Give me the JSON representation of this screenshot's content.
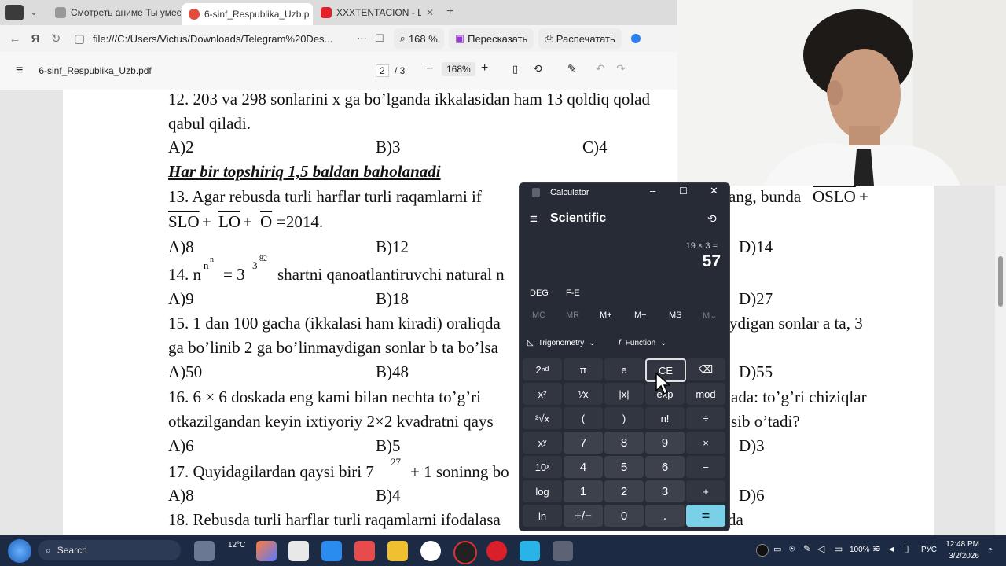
{
  "browser": {
    "tabs": [
      {
        "label": "Смотреть аниме Ты умее",
        "active": false
      },
      {
        "label": "6-sinf_Respublika_Uzb.p",
        "active": true
      },
      {
        "label": "XXXTENTACION - Le",
        "active": false
      }
    ],
    "address": "file:///C:/Users/Victus/Downloads/Telegram%20Des...",
    "zoom": "168 %",
    "retell_label": "Пересказать",
    "print_label": "Распечатать"
  },
  "pdf": {
    "filename": "6-sinf_Respublika_Uzb.pdf",
    "page_current": "2",
    "page_total": "/ 3",
    "zoom": "168%"
  },
  "document": {
    "lines": [
      "12. 203 va 298 sonlarini x ga bo’lganda ikkalasidan ham 13 qoldiq qolad",
      "qabul qiladi.",
      "Har bir topshiriq 1,5 baldan baholanadi",
      "13. Agar rebusda turli harflar turli raqamlarni if",
      "ang, bunda",
      "OSLO",
      "SLO",
      "LO",
      "O",
      "=2014.",
      "14. n",
      "shartni qanoatlantiruvchi  natural n",
      "15. 1 dan 100 gacha (ikkalasi ham kiradi) oraliqda",
      "ydigan sonlar a ta, 3",
      "ga bo’linib 2 ga bo’linmaydigan sonlar b ta bo’lsa",
      "16. 6 × 6 doskada eng kami bilan nechta to’g’ri",
      "ada: to’g’ri chiziqlar",
      "otkazilgandan keyin ixtiyoriy 2×2 kvadratni qays",
      "sib o’tadi?",
      "17. Quyidagilardan qaysi biri  7",
      "27",
      "+ 1 soninng bo",
      "18. Rebusda turli harflar turli raqamlarni ifodalasa",
      "da"
    ],
    "options": [
      [
        "A)2",
        "B)3",
        "C)4"
      ],
      [
        "A)8",
        "B)12",
        "D)14"
      ],
      [
        "A)9",
        "B)18",
        "D)27"
      ],
      [
        "A)50",
        "B)48",
        "D)55"
      ],
      [
        "A)6",
        "B)5",
        "D)3"
      ],
      [
        "A)8",
        "B)4",
        "D)6"
      ]
    ],
    "pow": {
      "n_sup": "n",
      "n_sup2": "n",
      "three": "= 3",
      "three_sup": "3",
      "three_sup2": "82"
    }
  },
  "calculator": {
    "title": "Calculator",
    "mode": "Scientific",
    "expression": "19 × 3 =",
    "result": "57",
    "angle": "DEG",
    "fe": "F-E",
    "memory": [
      "MC",
      "MR",
      "M+",
      "M−",
      "MS",
      "M⌄"
    ],
    "trig_label": "Trigonometry",
    "func_label": "Function",
    "keys": [
      [
        "2ⁿᵈ",
        "π",
        "e",
        "CE",
        "⌫"
      ],
      [
        "x²",
        "¹⁄x",
        "|x|",
        "exp",
        "mod"
      ],
      [
        "²√x",
        "(",
        ")",
        "n!",
        "÷"
      ],
      [
        "xʸ",
        "7",
        "8",
        "9",
        "×"
      ],
      [
        "10ˣ",
        "4",
        "5",
        "6",
        "−"
      ],
      [
        "log",
        "1",
        "2",
        "3",
        "+"
      ],
      [
        "ln",
        "+/−",
        "0",
        ".",
        "="
      ]
    ]
  },
  "taskbar": {
    "search": "Search",
    "weather": "12°C",
    "battery": "100%",
    "lang": "РУС",
    "time": "12:48 PM",
    "date": "3/2/2026"
  },
  "colors": {
    "calc_bg": "#262b36",
    "equals": "#7ad0e6",
    "taskbar": "#1d2a44",
    "tab_active_icon": "#e24c3c"
  }
}
